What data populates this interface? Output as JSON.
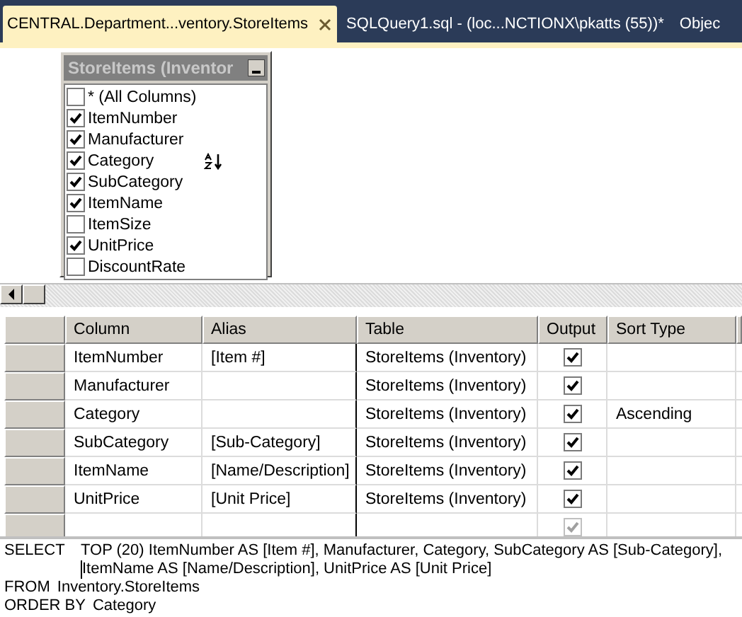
{
  "tabs": [
    {
      "label": "CENTRAL.Department...ventory.StoreItems",
      "selected": true
    },
    {
      "label": "SQLQuery1.sql - (loc...NCTIONX\\pkatts (55))*",
      "selected": false
    },
    {
      "label": "Objec",
      "selected": false
    }
  ],
  "diagram": {
    "table": {
      "title": "StoreItems (Inventor",
      "columns": [
        {
          "name": "* (All Columns)",
          "checked": false,
          "sorted": false
        },
        {
          "name": "ItemNumber",
          "checked": true,
          "sorted": false
        },
        {
          "name": "Manufacturer",
          "checked": true,
          "sorted": false
        },
        {
          "name": "Category",
          "checked": true,
          "sorted": true
        },
        {
          "name": "SubCategory",
          "checked": true,
          "sorted": false
        },
        {
          "name": "ItemName",
          "checked": true,
          "sorted": false
        },
        {
          "name": "ItemSize",
          "checked": false,
          "sorted": false
        },
        {
          "name": "UnitPrice",
          "checked": true,
          "sorted": false
        },
        {
          "name": "DiscountRate",
          "checked": false,
          "sorted": false
        }
      ]
    }
  },
  "criteria": {
    "columns": [
      "Column",
      "Alias",
      "Table",
      "Output",
      "Sort Type"
    ],
    "rows": [
      {
        "column": "ItemNumber",
        "alias": "[Item #]",
        "table": "StoreItems (Inventory)",
        "output": true,
        "disabled": false,
        "sort_type": null
      },
      {
        "column": "Manufacturer",
        "alias": null,
        "table": "StoreItems (Inventory)",
        "output": true,
        "disabled": false,
        "sort_type": null
      },
      {
        "column": "Category",
        "alias": null,
        "table": "StoreItems (Inventory)",
        "output": true,
        "disabled": false,
        "sort_type": "Ascending"
      },
      {
        "column": "SubCategory",
        "alias": "[Sub-Category]",
        "table": "StoreItems (Inventory)",
        "output": true,
        "disabled": false,
        "sort_type": null
      },
      {
        "column": "ItemName",
        "alias": "[Name/Description]",
        "table": "StoreItems (Inventory)",
        "output": true,
        "disabled": false,
        "sort_type": null
      },
      {
        "column": "UnitPrice",
        "alias": "[Unit Price]",
        "table": "StoreItems (Inventory)",
        "output": true,
        "disabled": false,
        "sort_type": null
      },
      {
        "column": null,
        "alias": null,
        "table": null,
        "output": true,
        "disabled": true,
        "sort_type": null
      }
    ]
  },
  "sql": [
    {
      "keyword": "SELECT",
      "lines": [
        {
          "text": "TOP (20) ItemNumber AS [Item #], Manufacturer, Category, SubCategory AS [Sub-Category],",
          "cursor": false
        },
        {
          "text": "ItemName AS [Name/Description], UnitPrice AS [Unit Price]",
          "cursor": true
        }
      ]
    },
    {
      "keyword": "FROM",
      "lines": [
        {
          "text": "Inventory.StoreItems",
          "cursor": false
        }
      ]
    },
    {
      "keyword": "ORDER BY",
      "lines": [
        {
          "text": "Category",
          "cursor": false
        }
      ]
    }
  ]
}
